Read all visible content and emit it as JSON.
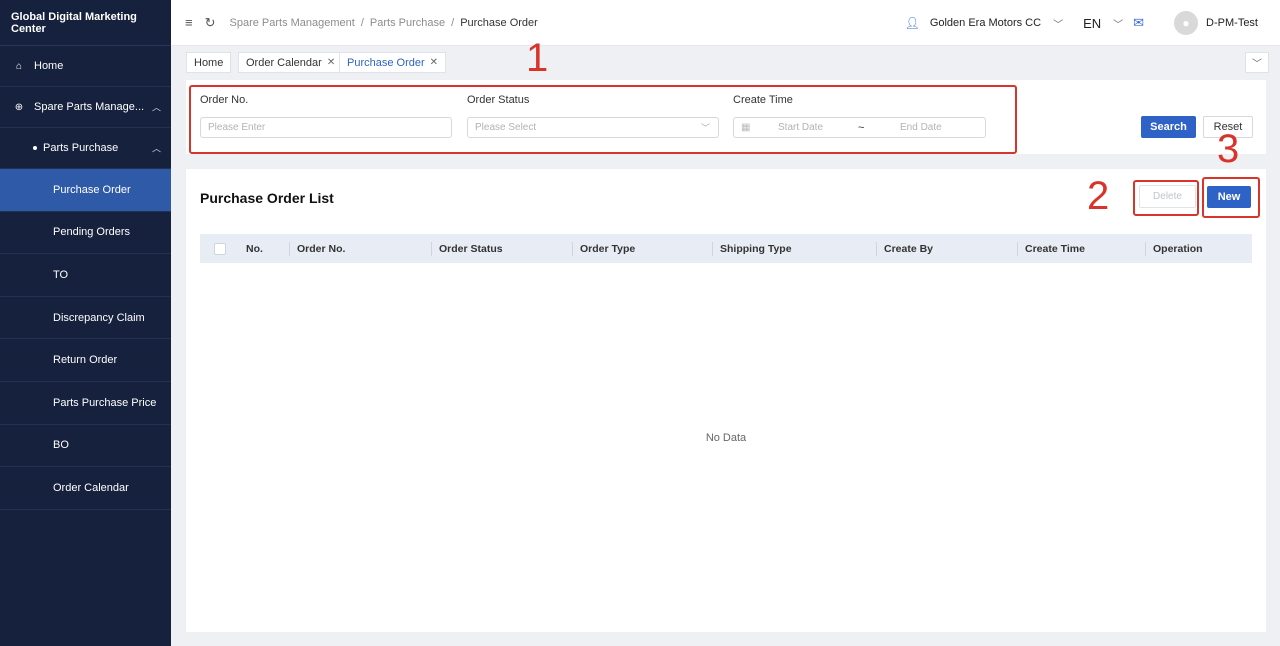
{
  "sidebar": {
    "title": "Global Digital Marketing Center",
    "home": "Home",
    "spare_parts": "Spare Parts Manage...",
    "parts_purchase": "Parts Purchase",
    "items": [
      {
        "label": "Purchase Order"
      },
      {
        "label": "Pending Orders"
      },
      {
        "label": "TO"
      },
      {
        "label": "Discrepancy Claim"
      },
      {
        "label": "Return Order"
      },
      {
        "label": "Parts Purchase Price"
      },
      {
        "label": "BO"
      },
      {
        "label": "Order Calendar"
      }
    ],
    "active_item": "Purchase Order"
  },
  "header": {
    "breadcrumb": [
      "Spare Parts Management",
      "Parts Purchase",
      "Purchase Order"
    ],
    "dealer": "Golden Era Motors CC",
    "language": "EN",
    "user": "D-PM-Test"
  },
  "tabs": [
    {
      "label": "Home",
      "closable": false
    },
    {
      "label": "Order Calendar",
      "closable": true
    },
    {
      "label": "Purchase Order",
      "closable": true,
      "active": true
    }
  ],
  "filter": {
    "order_no_label": "Order No.",
    "order_no_placeholder": "Please Enter",
    "order_status_label": "Order Status",
    "order_status_placeholder": "Please Select",
    "create_time_label": "Create Time",
    "start_placeholder": "Start Date",
    "range_sep": "~",
    "end_placeholder": "End Date",
    "search_label": "Search",
    "reset_label": "Reset"
  },
  "list": {
    "title": "Purchase Order List",
    "delete_label": "Delete",
    "new_label": "New",
    "columns": [
      "No.",
      "Order No.",
      "Order Status",
      "Order Type",
      "Shipping Type",
      "Create By",
      "Create Time",
      "Operation"
    ],
    "empty_text": "No Data"
  },
  "annotations": [
    "1",
    "2",
    "3"
  ],
  "colors": {
    "sidebar_bg": "#16213e",
    "sidebar_active": "#2f5aa8",
    "primary": "#2f62c6",
    "annotation": "#d9342b"
  }
}
